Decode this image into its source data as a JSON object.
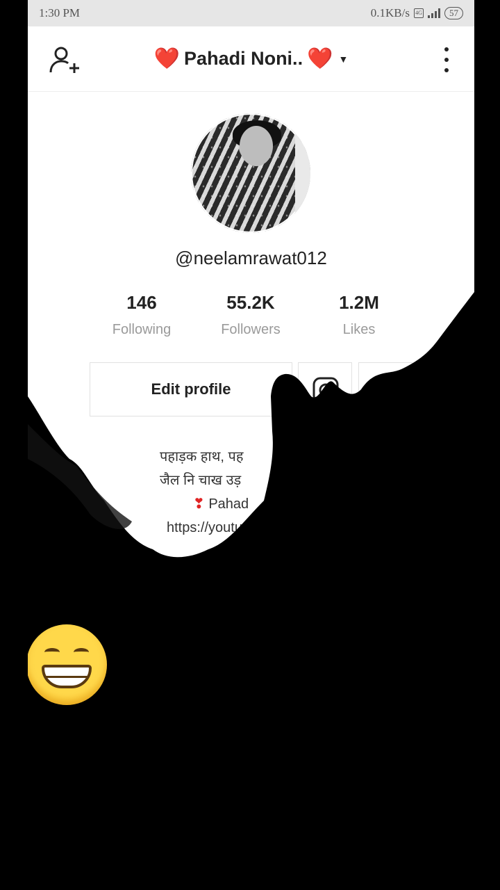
{
  "status_bar": {
    "time": "1:30 PM",
    "network_speed": "0.1KB/s",
    "battery": "57"
  },
  "header": {
    "title": "Pahadi Noni..",
    "heart_left": "❤️",
    "heart_right": "❤️",
    "add_user_icon": "add-user-icon",
    "more_icon": "more-vertical-icon"
  },
  "profile": {
    "username": "@neelamrawat012",
    "stats": [
      {
        "value": "146",
        "label": "Following"
      },
      {
        "value": "55.2K",
        "label": "Followers"
      },
      {
        "value": "1.2M",
        "label": "Likes"
      }
    ],
    "edit_label": "Edit profile",
    "bio_line1": "पहाड़क हाथ, पह",
    "bio_line2": "जैल नि चाख उड़",
    "bio_line3": "Pahad",
    "bio_heart": "❣",
    "bio_link": "https://youtu"
  },
  "overlay": {
    "emoji": "grinning-face-emoji"
  }
}
